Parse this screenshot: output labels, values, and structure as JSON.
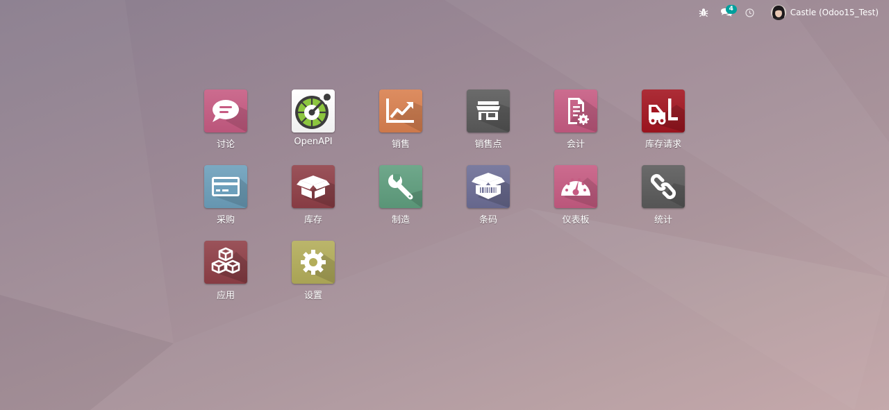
{
  "navbar": {
    "chat_count": "4",
    "user_name": "Castle (Odoo15_Test)",
    "icons": [
      "bug-icon",
      "chat-icon",
      "clock-icon",
      "user-avatar"
    ]
  },
  "apps": [
    {
      "label": "讨论",
      "icon": "chat-bubble-icon",
      "color": "#c65b82"
    },
    {
      "label": "OpenAPI",
      "icon": "openapi-gauge-icon",
      "color": "#ffffff"
    },
    {
      "label": "销售",
      "icon": "line-chart-icon",
      "color": "#d9804f"
    },
    {
      "label": "销售点",
      "icon": "store-icon",
      "color": "#5a5a5a"
    },
    {
      "label": "会计",
      "icon": "invoice-icon",
      "color": "#c65b82"
    },
    {
      "label": "库存请求",
      "icon": "forklift-icon",
      "color": "#a31520"
    },
    {
      "label": "采购",
      "icon": "credit-card-icon",
      "color": "#6c9fbb"
    },
    {
      "label": "库存",
      "icon": "open-box-icon",
      "color": "#8f3f47"
    },
    {
      "label": "制造",
      "icon": "wrench-icon",
      "color": "#5f9e7e"
    },
    {
      "label": "条码",
      "icon": "barcode-box-icon",
      "color": "#6c6d95"
    },
    {
      "label": "仪表板",
      "icon": "dashboard-gauge-icon",
      "color": "#c65b82"
    },
    {
      "label": "统计",
      "icon": "link-icon",
      "color": "#5a5a5a"
    },
    {
      "label": "应用",
      "icon": "cubes-icon",
      "color": "#8f3f47"
    },
    {
      "label": "设置",
      "icon": "gear-icon",
      "color": "#b3ad5a"
    }
  ]
}
